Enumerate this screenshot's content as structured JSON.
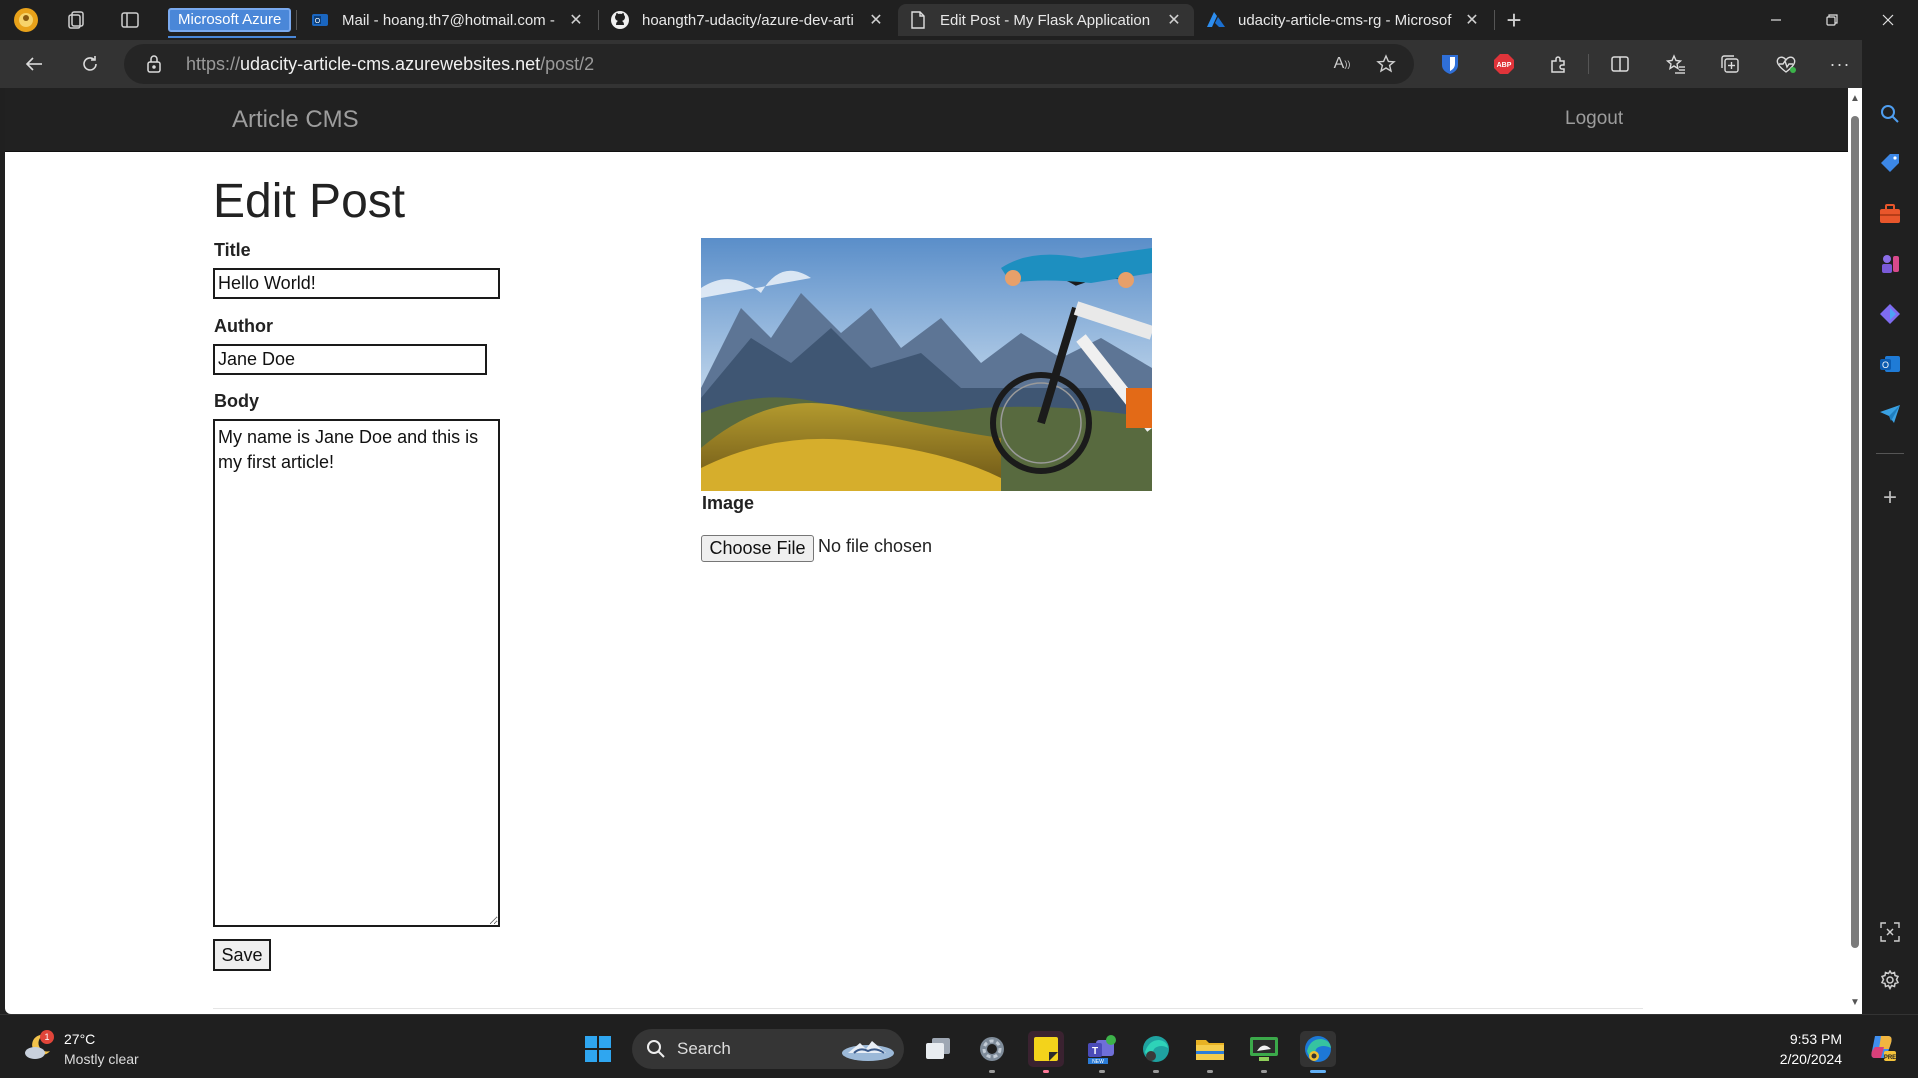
{
  "browser": {
    "group_label": "Microsoft Azure",
    "tabs": [
      {
        "title": "Mail - hoang.th7@hotmail.com -",
        "icon": "outlook-icon"
      },
      {
        "title": "hoangth7-udacity/azure-dev-arti",
        "icon": "github-icon"
      },
      {
        "title": "Edit Post - My Flask Application",
        "icon": "page-icon",
        "active": true
      },
      {
        "title": "udacity-article-cms-rg - Microsof",
        "icon": "azure-icon"
      }
    ],
    "address": {
      "scheme": "https://",
      "host": "udacity-article-cms.azurewebsites.net",
      "path": "/post/2"
    },
    "accent_color": "#4a87d8"
  },
  "site": {
    "brand": "Article CMS",
    "logout": "Logout",
    "navbar_color": "#212121"
  },
  "form": {
    "heading": "Edit Post",
    "title_label": "Title",
    "title_value": "Hello World!",
    "author_label": "Author",
    "author_value": "Jane Doe",
    "body_label": "Body",
    "body_value": "My name is Jane Doe and this is my first article!",
    "image_label": "Image",
    "choose_file": "Choose File",
    "no_file": "No file chosen",
    "save": "Save"
  },
  "taskbar": {
    "weather_temp": "27°C",
    "weather_desc": "Mostly clear",
    "weather_badge": "1",
    "search": "Search",
    "time": "9:53 PM",
    "date": "2/20/2024"
  }
}
